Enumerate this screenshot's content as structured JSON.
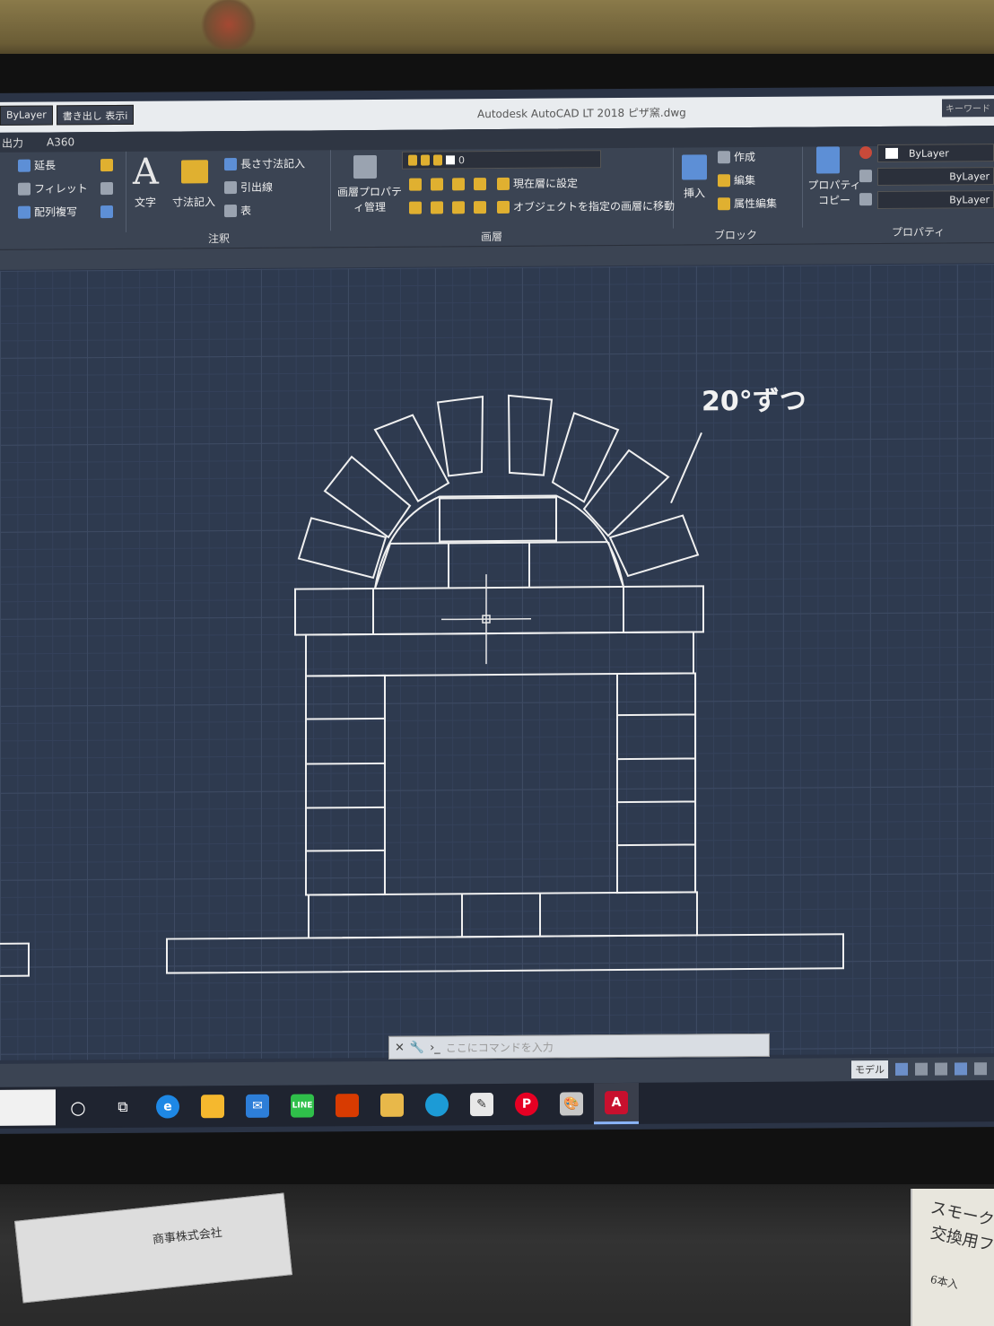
{
  "window": {
    "title": "Autodesk AutoCAD LT 2018   ピザ窯.dwg",
    "keyword_box": "キーワード"
  },
  "quick_access": {
    "layer_dropdown": "ByLayer",
    "plot_dropdown": "書き出し 表示i"
  },
  "tabs": [
    "出力",
    "A360"
  ],
  "ribbon": {
    "modify": [
      "延長",
      "フィレット",
      "配列複写"
    ],
    "annotation": {
      "text": "文字",
      "dimension": "寸法記入",
      "linear_dim": "長さ寸法記入",
      "leader": "引出線",
      "table": "表",
      "label": "注釈"
    },
    "layers": {
      "layer_properties": "画層プロパティ管理",
      "current_layer": "0",
      "set_current": "現在層に設定",
      "match_layer": "オブジェクトを指定の画層に移動",
      "label": "画層"
    },
    "block": {
      "insert": "挿入",
      "create": "作成",
      "edit": "編集",
      "edit_attributes": "属性編集",
      "label": "ブロック"
    },
    "properties": {
      "match": "プロパティコピー",
      "color": "ByLayer",
      "linetype": "ByLayer",
      "lineweight": "ByLayer",
      "label": "プロパティ"
    }
  },
  "drawing": {
    "annotation": "20°ずつ"
  },
  "command_line": {
    "placeholder": "ここにコマンドを入力"
  },
  "status": {
    "model": "モデル"
  },
  "desk": {
    "paper_company": "商事株式会社",
    "box_line1": "スモーク",
    "box_line2": "交換用フ",
    "box_line3": "6本入"
  }
}
